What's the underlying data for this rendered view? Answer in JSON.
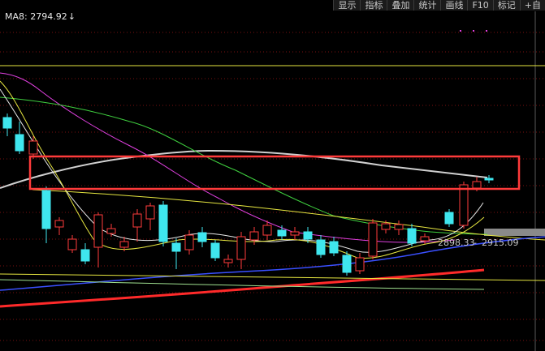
{
  "toolbar": {
    "buttons": [
      "显示",
      "指标",
      "叠加",
      "统计",
      "画线",
      "F10",
      "标记",
      "+自"
    ]
  },
  "legend": {
    "ma_label": "MA8:",
    "ma_value": "2794.92",
    "arrow": "↓"
  },
  "annotations": {
    "range_low": "2898.33",
    "separator": "-",
    "range_high": "2915.09"
  },
  "colors": {
    "up": "#ff3b3b",
    "down": "#3fe6ee",
    "highlight_box": "#ff3b3b"
  }
}
